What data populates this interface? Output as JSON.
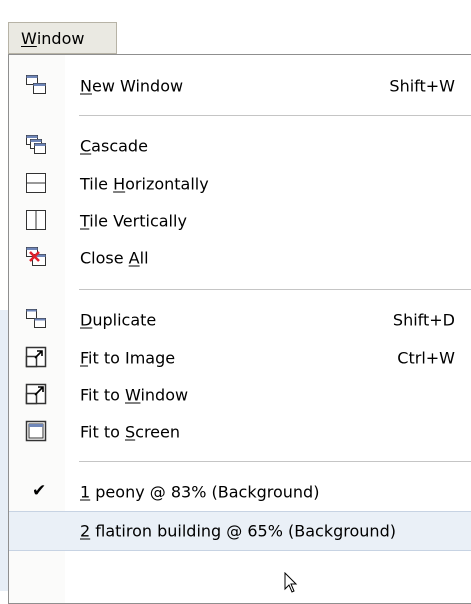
{
  "menubar": {
    "window": {
      "mnemonic": "W",
      "rest": "indow"
    }
  },
  "menu": {
    "new_window": {
      "mn": "N",
      "rest": "ew Window",
      "shortcut": "Shift+W",
      "icon": "new-window-icon"
    },
    "cascade": {
      "mn": "C",
      "rest": "ascade",
      "icon": "cascade-icon"
    },
    "tile_h": {
      "pre": "Tile ",
      "mn": "H",
      "rest": "orizontally",
      "icon": "tile-horizontal-icon"
    },
    "tile_v": {
      "mn": "T",
      "rest": "ile Vertically",
      "icon": "tile-vertical-icon"
    },
    "close_all": {
      "pre": "Close ",
      "mn": "A",
      "rest": "ll",
      "icon": "close-all-icon"
    },
    "duplicate": {
      "mn": "D",
      "rest": "uplicate",
      "shortcut": "Shift+D",
      "icon": "duplicate-icon"
    },
    "fit_image": {
      "mn": "F",
      "rest": "it to Image",
      "shortcut": "Ctrl+W",
      "icon": "fit-to-image-icon"
    },
    "fit_window": {
      "pre": "Fit to ",
      "mn": "W",
      "rest": "indow",
      "icon": "fit-to-window-icon"
    },
    "fit_screen": {
      "pre": "Fit to ",
      "mn": "S",
      "rest": "creen",
      "icon": "fit-to-screen-icon"
    },
    "doc1": {
      "mn": "1",
      "rest": " peony @  83% (Background)",
      "checked": true
    },
    "doc2": {
      "mn": "2",
      "rest": " flatiron building @  65% (Background)"
    }
  }
}
